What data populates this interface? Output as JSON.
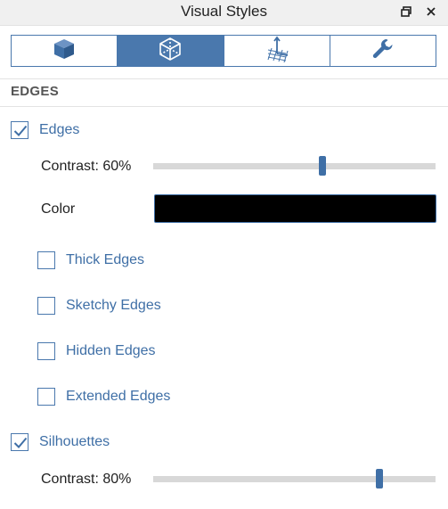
{
  "window": {
    "title": "Visual Styles",
    "restore_icon": "restore-window-icon",
    "close_icon": "close-icon"
  },
  "tabs": [
    {
      "icon": "solid-cube-icon",
      "active": false
    },
    {
      "icon": "wireframe-cube-icon",
      "active": true
    },
    {
      "icon": "grid-axes-icon",
      "active": false
    },
    {
      "icon": "wrench-icon",
      "active": false
    }
  ],
  "section": {
    "title": "EDGES"
  },
  "edges": {
    "label": "Edges",
    "checked": true,
    "contrast_label": "Contrast: 60%",
    "contrast_value": 60,
    "color_label": "Color",
    "color_value": "#000000"
  },
  "options": [
    {
      "label": "Thick Edges",
      "checked": false
    },
    {
      "label": "Sketchy Edges",
      "checked": false
    },
    {
      "label": "Hidden Edges",
      "checked": false
    },
    {
      "label": "Extended Edges",
      "checked": false
    }
  ],
  "silhouettes": {
    "label": "Silhouettes",
    "checked": true,
    "contrast_label": "Contrast: 80%",
    "contrast_value": 80
  },
  "colors": {
    "accent": "#4a78ad",
    "label": "#3f6fa6"
  }
}
